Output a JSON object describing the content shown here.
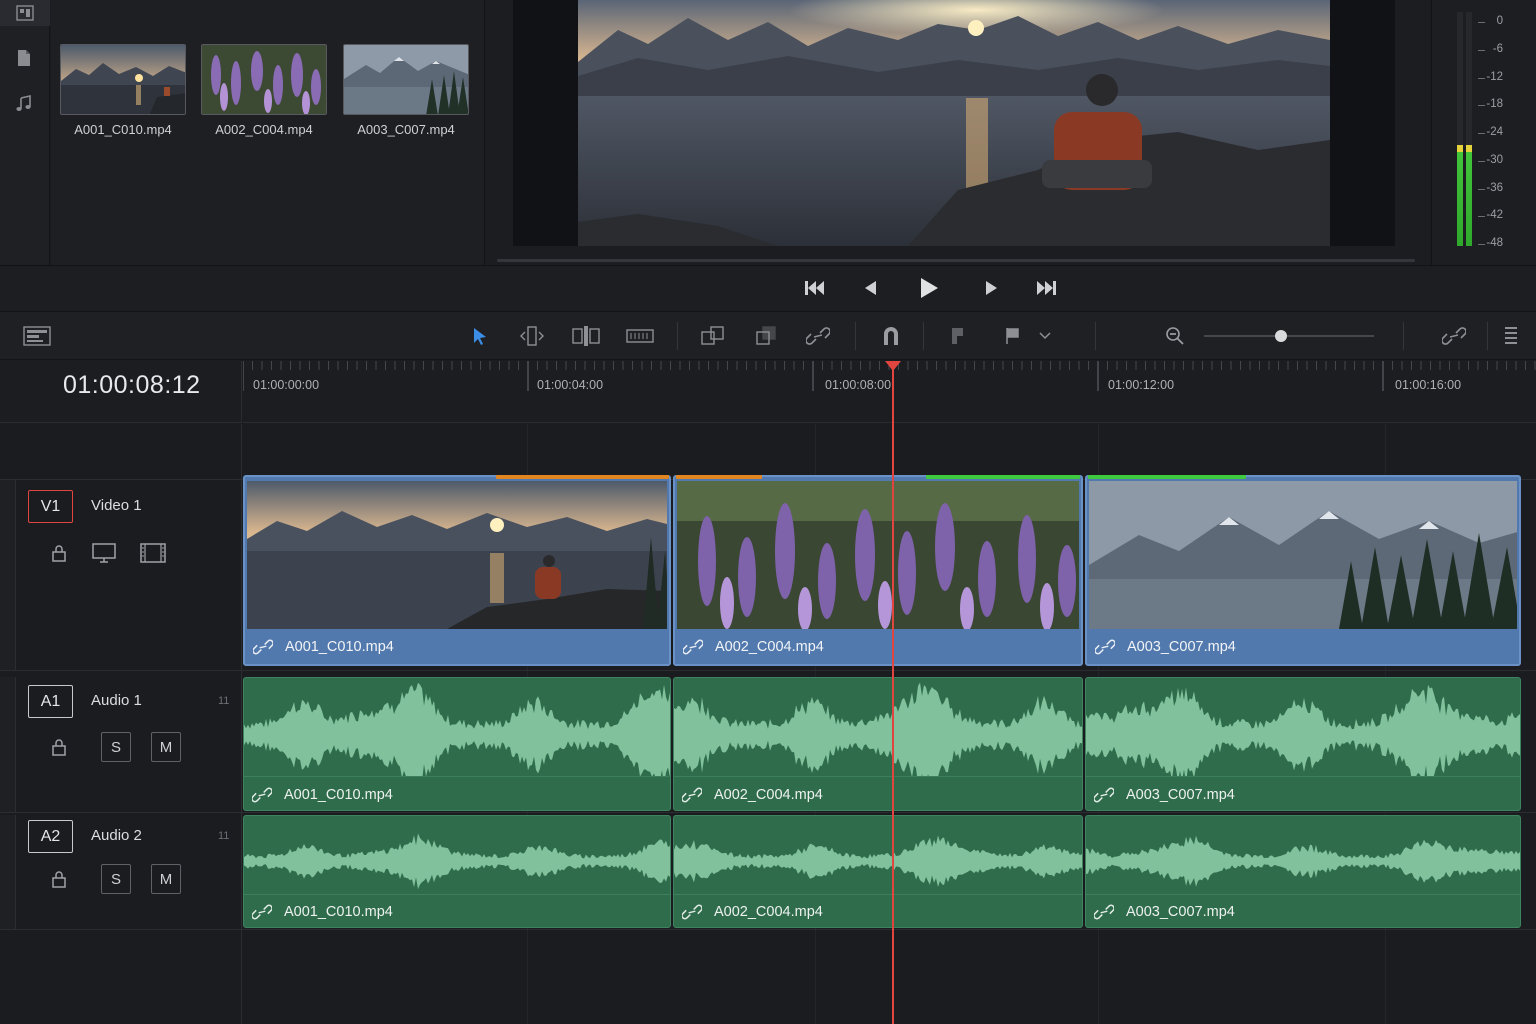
{
  "media_pool": {
    "clips": [
      {
        "name": "A001_C010.mp4"
      },
      {
        "name": "A002_C004.mp4"
      },
      {
        "name": "A003_C007.mp4"
      }
    ]
  },
  "audio_meter": {
    "scale": [
      "0",
      "-6",
      "-12",
      "-18",
      "-24",
      "-30",
      "-36",
      "-42",
      "-48"
    ],
    "levels": [
      0.43,
      0.43
    ]
  },
  "timeline": {
    "timecode": "01:00:08:12",
    "ruler": [
      "01:00:00:00",
      "01:00:04:00",
      "01:00:08:00",
      "01:00:12:00",
      "01:00:16:00"
    ],
    "tracks": [
      {
        "badge": "V1",
        "name": "Video 1"
      },
      {
        "badge": "A1",
        "name": "Audio 1",
        "num": "11",
        "solo": "S",
        "mute": "M"
      },
      {
        "badge": "A2",
        "name": "Audio 2",
        "num": "11",
        "solo": "S",
        "mute": "M"
      }
    ],
    "video_clips": [
      {
        "name": "A001_C010.mp4"
      },
      {
        "name": "A002_C004.mp4"
      },
      {
        "name": "A003_C007.mp4"
      }
    ],
    "audio1_clips": [
      {
        "name": "A001_C010.mp4"
      },
      {
        "name": "A002_C004.mp4"
      },
      {
        "name": "A003_C007.mp4"
      }
    ],
    "audio2_clips": [
      {
        "name": "A001_C010.mp4"
      },
      {
        "name": "A002_C004.mp4"
      },
      {
        "name": "A003_C007.mp4"
      }
    ]
  },
  "colors": {
    "accent": "#3b8de6",
    "playhead": "#e0463f",
    "video_clip": "#5279ad",
    "audio_clip": "#2f6c4c",
    "marker_orange": "#e0851f",
    "marker_green": "#3ec93e"
  }
}
